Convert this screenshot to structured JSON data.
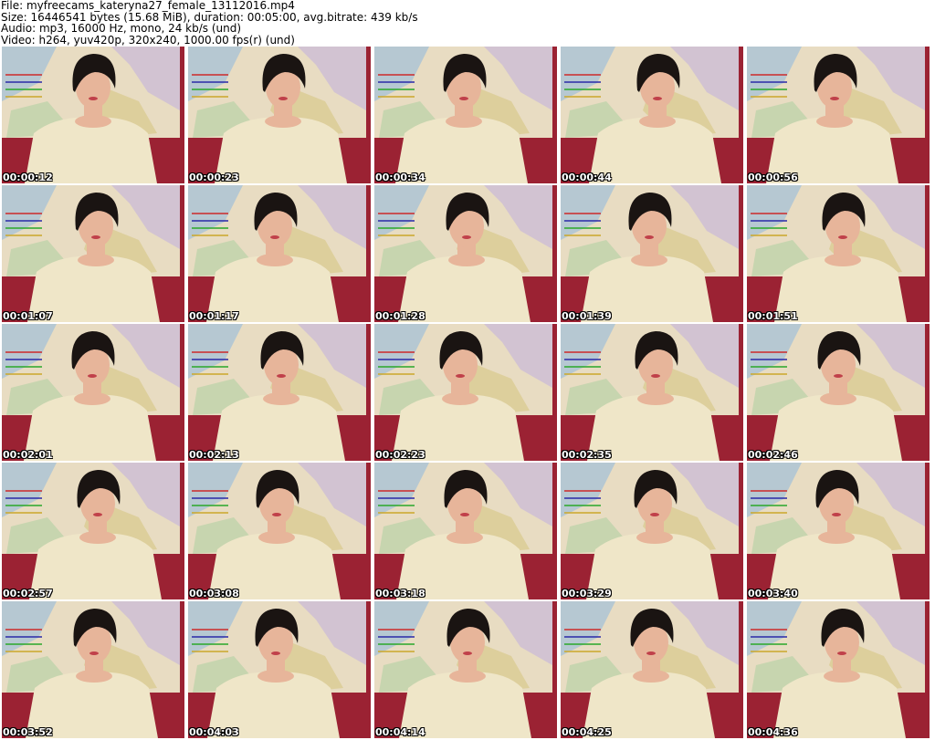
{
  "header": {
    "file_line": "File: myfreecams_kateryna27_female_13112016.mp4",
    "size_line": "Size: 16446541 bytes (15.68 MiB), duration: 00:05:00, avg.bitrate: 439 kb/s",
    "audio_line": "Audio: mp3, 16000 Hz, mono, 24 kb/s (und)",
    "video_line": "Video: h264, yuv420p, 320x240, 1000.00 fps(r) (und)"
  },
  "colors": {
    "wall": "#9b2233",
    "map_bg": "#e8dcc2",
    "map_sea": "#a9c3d6",
    "sweater": "#efe6c8",
    "hair": "#1a1412",
    "skin": "#e7b59a"
  },
  "thumbnails": [
    {
      "timestamp": "00:00:12"
    },
    {
      "timestamp": "00:00:23"
    },
    {
      "timestamp": "00:00:34"
    },
    {
      "timestamp": "00:00:44"
    },
    {
      "timestamp": "00:00:56"
    },
    {
      "timestamp": "00:01:07"
    },
    {
      "timestamp": "00:01:17"
    },
    {
      "timestamp": "00:01:28"
    },
    {
      "timestamp": "00:01:39"
    },
    {
      "timestamp": "00:01:51"
    },
    {
      "timestamp": "00:02:01"
    },
    {
      "timestamp": "00:02:13"
    },
    {
      "timestamp": "00:02:23"
    },
    {
      "timestamp": "00:02:35"
    },
    {
      "timestamp": "00:02:46"
    },
    {
      "timestamp": "00:02:57"
    },
    {
      "timestamp": "00:03:08"
    },
    {
      "timestamp": "00:03:18"
    },
    {
      "timestamp": "00:03:29"
    },
    {
      "timestamp": "00:03:40"
    },
    {
      "timestamp": "00:03:52"
    },
    {
      "timestamp": "00:04:03"
    },
    {
      "timestamp": "00:04:14"
    },
    {
      "timestamp": "00:04:25"
    },
    {
      "timestamp": "00:04:36"
    }
  ]
}
